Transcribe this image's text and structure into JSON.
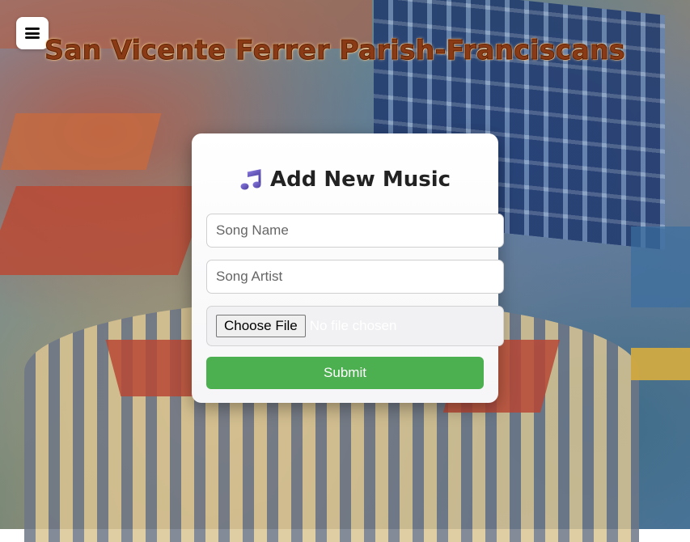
{
  "header": {
    "site_title": "San Vicente Ferrer Parish-Franciscans",
    "menu_icon": "hamburger-menu-icon"
  },
  "form": {
    "title": "Add New Music",
    "title_icon": "music-note-icon",
    "song_name_placeholder": "Song Name",
    "song_artist_placeholder": "Song Artist",
    "file_button_label": "Choose File",
    "file_status": "No file chosen",
    "submit_label": "Submit"
  },
  "colors": {
    "title_text": "#8a3a14",
    "submit_bg": "#4caf50",
    "icon_purple": "#6a5acd"
  }
}
